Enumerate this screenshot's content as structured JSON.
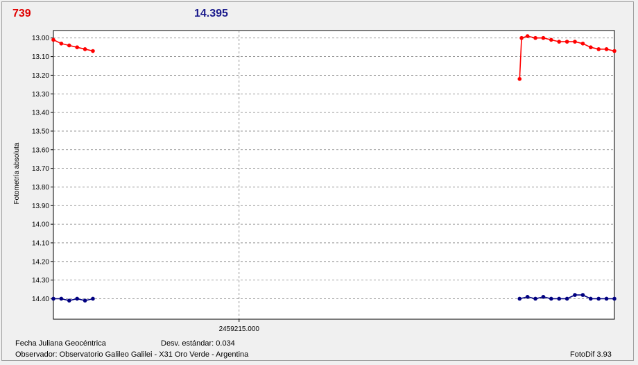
{
  "header": {
    "value_red": "739",
    "value_blue": "14.395"
  },
  "footer": {
    "xlabel": "Fecha Juliana Geocéntrica",
    "std_dev": "Desv. estándar: 0.034",
    "observer": "Observador: Observatorio Galileo Galilei - X31 Oro Verde - Argentina",
    "version": "FotoDif 3.93"
  },
  "colors": {
    "red_series": "#ff0000",
    "blue_series": "#000080",
    "grid": "#808080"
  },
  "chart_data": {
    "type": "scatter",
    "title": "",
    "xlabel": "Fecha Juliana Geocéntrica",
    "ylabel": "Fotometría absoluta",
    "y_inverted": true,
    "ylim": [
      12.96,
      14.51
    ],
    "yticks": [
      "13.00",
      "13.10",
      "13.20",
      "13.30",
      "13.40",
      "13.50",
      "13.60",
      "13.70",
      "13.80",
      "13.90",
      "14.00",
      "14.10",
      "14.20",
      "14.30",
      "14.40"
    ],
    "xlim": [
      2459214.953,
      2459215.095
    ],
    "xticks": [
      "2459215.000"
    ],
    "grid": true,
    "legend": "none",
    "series": [
      {
        "color": "#ff0000",
        "style": "line-markers",
        "segments": [
          {
            "x": [
              2459214.953,
              2459214.955,
              2459214.957,
              2459214.959,
              2459214.961,
              2459214.963
            ],
            "y": [
              13.01,
              13.03,
              13.04,
              13.05,
              13.06,
              13.07
            ]
          },
          {
            "x": [
              2459215.071,
              2459215.0715,
              2459215.073,
              2459215.075,
              2459215.077,
              2459215.079,
              2459215.081,
              2459215.083,
              2459215.085,
              2459215.087,
              2459215.089,
              2459215.091,
              2459215.093,
              2459215.095
            ],
            "y": [
              13.22,
              13.0,
              12.99,
              13.0,
              13.0,
              13.01,
              13.02,
              13.02,
              13.02,
              13.03,
              13.05,
              13.06,
              13.06,
              13.07
            ]
          }
        ]
      },
      {
        "color": "#000080",
        "style": "line-markers",
        "segments": [
          {
            "x": [
              2459214.953,
              2459214.955,
              2459214.957,
              2459214.959,
              2459214.961,
              2459214.963
            ],
            "y": [
              14.4,
              14.4,
              14.41,
              14.4,
              14.41,
              14.4
            ]
          },
          {
            "x": [
              2459215.071,
              2459215.073,
              2459215.075,
              2459215.077,
              2459215.079,
              2459215.081,
              2459215.083,
              2459215.085,
              2459215.087,
              2459215.089,
              2459215.091,
              2459215.093,
              2459215.095
            ],
            "y": [
              14.4,
              14.39,
              14.4,
              14.39,
              14.4,
              14.4,
              14.4,
              14.38,
              14.38,
              14.4,
              14.4,
              14.4,
              14.4
            ]
          }
        ]
      }
    ]
  }
}
